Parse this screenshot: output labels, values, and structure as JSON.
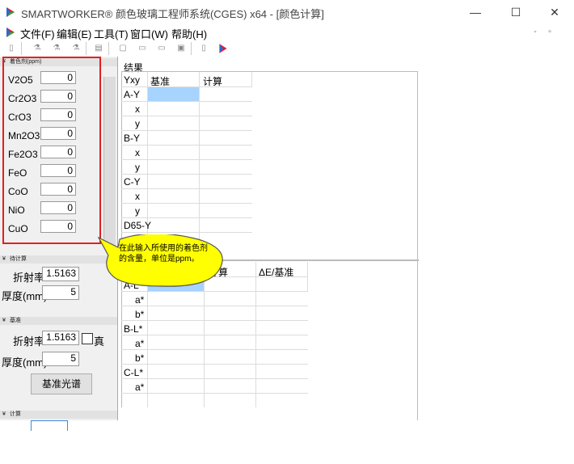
{
  "window": {
    "title": "SMARTWORKER® 颜色玻璃工程师系统(CGES) x64  - [颜色计算]",
    "minimize_glyph": "—",
    "maximize_glyph": "☐",
    "close_glyph": "✕"
  },
  "menu": {
    "items": [
      "文件(F)",
      "编辑(E)",
      "工具(T)",
      "窗口(W)",
      "帮助(H)"
    ]
  },
  "mdi": {
    "minimize_glyph": "-",
    "restore_glyph": "▫"
  },
  "colorants_panel": {
    "header": "着色剂(ppm)",
    "fields": [
      {
        "label": "V2O5",
        "value": "0"
      },
      {
        "label": "Cr2O3",
        "value": "0"
      },
      {
        "label": "CrO3",
        "value": "0"
      },
      {
        "label": "Mn2O3",
        "value": "0"
      },
      {
        "label": "Fe2O3",
        "value": "0"
      },
      {
        "label": "FeO",
        "value": "0"
      },
      {
        "label": "CoO",
        "value": "0"
      },
      {
        "label": "NiO",
        "value": "0"
      },
      {
        "label": "CuO",
        "value": "0"
      }
    ]
  },
  "calc_panel": {
    "header": "待计算",
    "refractive_label": "折射率",
    "refractive_value": "1.5163",
    "thickness_label": "厚度(mm)",
    "thickness_value": "5"
  },
  "standard_panel": {
    "header": "基准",
    "refractive_label": "折射率",
    "refractive_value": "1.5163",
    "true_label": "真",
    "thickness_label": "厚度(mm)",
    "thickness_value": "5",
    "spectrum_button": "基准光谱"
  },
  "compute_panel": {
    "header": "计算"
  },
  "results": {
    "title": "结果",
    "yxy_headers": [
      "Yxy",
      "基准",
      "计算"
    ],
    "yxy_rows": [
      "A-Y",
      "x",
      "y",
      "B-Y",
      "x",
      "y",
      "C-Y",
      "x",
      "y",
      "D65-Y"
    ],
    "lab_headers": [
      "计算",
      "ΔE/基准"
    ],
    "lab_rows": [
      "A-L*",
      "a*",
      "b*",
      "B-L*",
      "a*",
      "b*",
      "C-L*",
      "a*"
    ]
  },
  "callout": {
    "text": "在此输入所使用的着色剂的含量，单位是ppm。"
  },
  "colors": {
    "annotation_red": "#e02020",
    "callout_fill": "#ffff00",
    "selected_cell": "#a7d3ff"
  }
}
